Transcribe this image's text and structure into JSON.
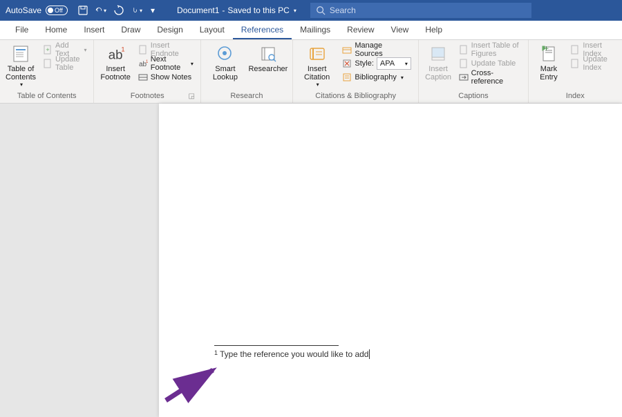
{
  "titlebar": {
    "autosave_label": "AutoSave",
    "autosave_state": "Off",
    "doc_name": "Document1",
    "saved_status": "Saved to this PC",
    "search_placeholder": "Search"
  },
  "tabs": {
    "file": "File",
    "home": "Home",
    "insert": "Insert",
    "draw": "Draw",
    "design": "Design",
    "layout": "Layout",
    "references": "References",
    "mailings": "Mailings",
    "review": "Review",
    "view": "View",
    "help": "Help"
  },
  "ribbon": {
    "toc": {
      "button": "Table of\nContents",
      "add_text": "Add Text",
      "update": "Update Table",
      "group": "Table of Contents"
    },
    "footnotes": {
      "insert_footnote": "Insert\nFootnote",
      "insert_endnote": "Insert Endnote",
      "next_footnote": "Next Footnote",
      "show_notes": "Show Notes",
      "group": "Footnotes"
    },
    "research": {
      "smart_lookup": "Smart\nLookup",
      "researcher": "Researcher",
      "group": "Research"
    },
    "citations": {
      "insert_citation": "Insert\nCitation",
      "manage": "Manage Sources",
      "style_label": "Style:",
      "style_value": "APA",
      "bibliography": "Bibliography",
      "group": "Citations & Bibliography"
    },
    "captions": {
      "insert_caption": "Insert\nCaption",
      "tof": "Insert Table of Figures",
      "update": "Update Table",
      "cross": "Cross-reference",
      "group": "Captions"
    },
    "index": {
      "mark_entry": "Mark\nEntry",
      "insert_index": "Insert Index",
      "update_index": "Update Index",
      "group": "Index"
    }
  },
  "document": {
    "footnote_num": "1",
    "footnote_text": "Type the reference you would like to add"
  }
}
